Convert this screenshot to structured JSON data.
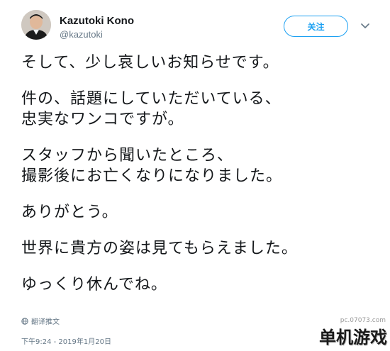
{
  "user": {
    "name": "Kazutoki Kono",
    "handle": "@kazutoki"
  },
  "actions": {
    "follow_label": "关注"
  },
  "tweet": {
    "paragraphs": [
      [
        "そして、少し哀しいお知らせです。"
      ],
      [
        "件の、話題にしていただいている、",
        "忠実なワンコですが。"
      ],
      [
        "スタッフから聞いたところ、",
        "撮影後にお亡くなりになりました。"
      ],
      [
        "ありがとう。"
      ],
      [
        "世界に貴方の姿は見てもらえました。"
      ],
      [
        "ゆっくり休んでね。"
      ]
    ]
  },
  "translate": {
    "label": "翻译推文",
    "icon": "globe-icon"
  },
  "timestamp": "下午9:24 - 2019年1月20日",
  "watermark": {
    "text": "单机游戏",
    "url": "pc.07073.com"
  },
  "colors": {
    "accent": "#1da1f2",
    "secondary_text": "#657786",
    "primary_text": "#14171a"
  }
}
